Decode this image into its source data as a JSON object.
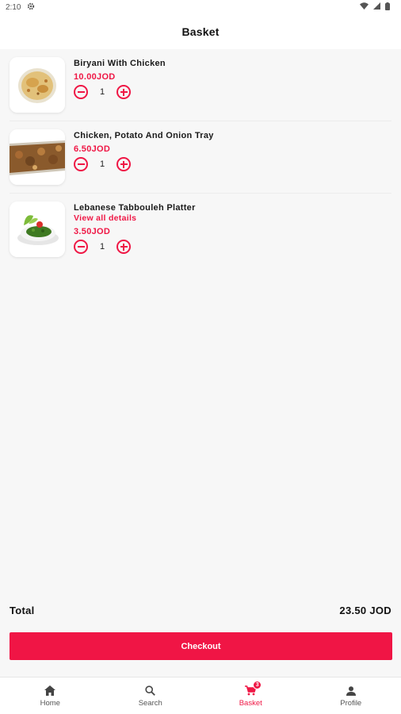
{
  "status_bar": {
    "time": "2:10"
  },
  "header": {
    "title": "Basket"
  },
  "items": [
    {
      "name": "Biryani With Chicken",
      "link": "",
      "price": "10.00JOD",
      "quantity": "1"
    },
    {
      "name": "Chicken, Potato And Onion Tray",
      "link": "",
      "price": "6.50JOD",
      "quantity": "1"
    },
    {
      "name": "Lebanese Tabbouleh Platter",
      "link": "View all details",
      "price": "3.50JOD",
      "quantity": "1"
    }
  ],
  "total": {
    "label": "Total",
    "value": "23.50 JOD"
  },
  "checkout": {
    "label": "Checkout"
  },
  "nav": {
    "home": "Home",
    "search": "Search",
    "basket": "Basket",
    "basket_badge": "3",
    "profile": "Profile"
  },
  "colors": {
    "accent": "#ef1745",
    "background": "#f7f7f7"
  },
  "icons": [
    "settings-icon",
    "wifi-icon",
    "signal-icon",
    "battery-icon",
    "minus-icon",
    "plus-icon",
    "home-icon",
    "search-icon",
    "cart-icon",
    "person-icon"
  ]
}
